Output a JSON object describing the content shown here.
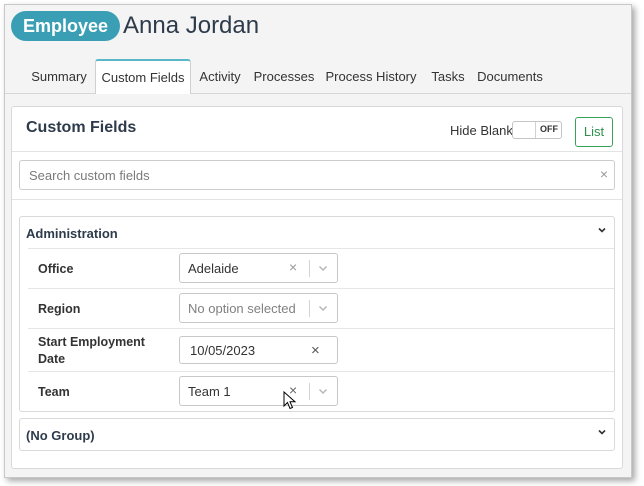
{
  "header": {
    "badge": "Employee",
    "name": "Anna Jordan"
  },
  "tabs": [
    {
      "label": "Summary",
      "active": false
    },
    {
      "label": "Custom Fields",
      "active": true
    },
    {
      "label": "Activity",
      "active": false
    },
    {
      "label": "Processes",
      "active": false
    },
    {
      "label": "Process History",
      "active": false
    },
    {
      "label": "Tasks",
      "active": false
    },
    {
      "label": "Documents",
      "active": false
    }
  ],
  "panel": {
    "title": "Custom Fields",
    "hide_blank_label": "Hide Blank",
    "toggle_state": "OFF",
    "list_button": "List",
    "search_placeholder": "Search custom fields",
    "search_clear": "×"
  },
  "groups": [
    {
      "title": "Administration",
      "expanded": true,
      "fields": [
        {
          "label": "Office",
          "value": "Adelaide",
          "kind": "select",
          "clearable": true
        },
        {
          "label": "Region",
          "value": "No option selected",
          "kind": "select",
          "clearable": false
        },
        {
          "label_line1": "Start Employment",
          "label_line2": "Date",
          "value": "10/05/2023",
          "kind": "date",
          "clearable": true
        },
        {
          "label": "Team",
          "value": "Team 1",
          "kind": "select",
          "clearable": true
        }
      ]
    },
    {
      "title": "(No Group)",
      "expanded": false
    }
  ],
  "icons": {
    "clear": "×",
    "chevron": "chevron-down-icon"
  },
  "colors": {
    "badge": "#3a9fb5",
    "active_tab_accent": "#5ab7c8",
    "list_button": "#3aa35a"
  }
}
